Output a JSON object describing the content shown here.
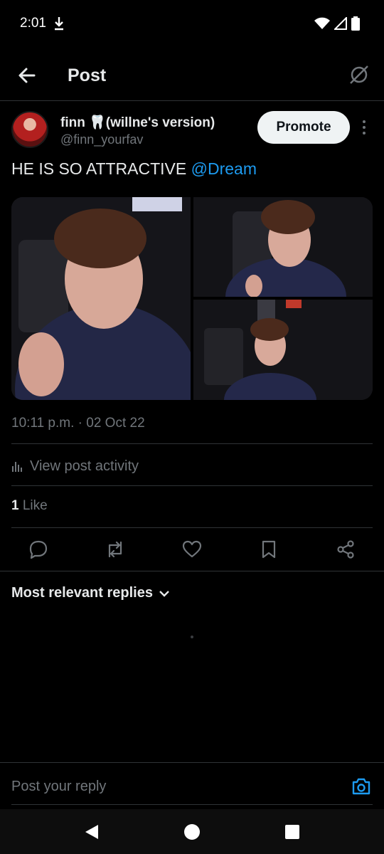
{
  "status_bar": {
    "time": "2:01"
  },
  "header": {
    "title": "Post"
  },
  "post": {
    "author_name": "finn 🦷(willne's version)",
    "author_handle": "@finn_yourfav",
    "promote_label": "Promote",
    "text": "HE IS SO ATTRACTIVE ",
    "mention": "@Dream",
    "timestamp": "10:11 p.m. · 02 Oct 22",
    "view_activity_label": "View post activity",
    "likes_count": "1",
    "likes_label": " Like"
  },
  "replies": {
    "sort_label": "Most relevant replies"
  },
  "reply_bar": {
    "placeholder": "Post your reply"
  },
  "colors": {
    "accent": "#1d9bf0",
    "background": "#000000",
    "muted": "#71767b",
    "divider": "#2f3336"
  },
  "icons": [
    "back-arrow-icon",
    "no-signal-icon",
    "more-vertical-icon",
    "bar-chart-icon",
    "reply-icon",
    "repost-icon",
    "like-icon",
    "bookmark-icon",
    "share-icon",
    "chevron-down-icon",
    "camera-icon"
  ]
}
